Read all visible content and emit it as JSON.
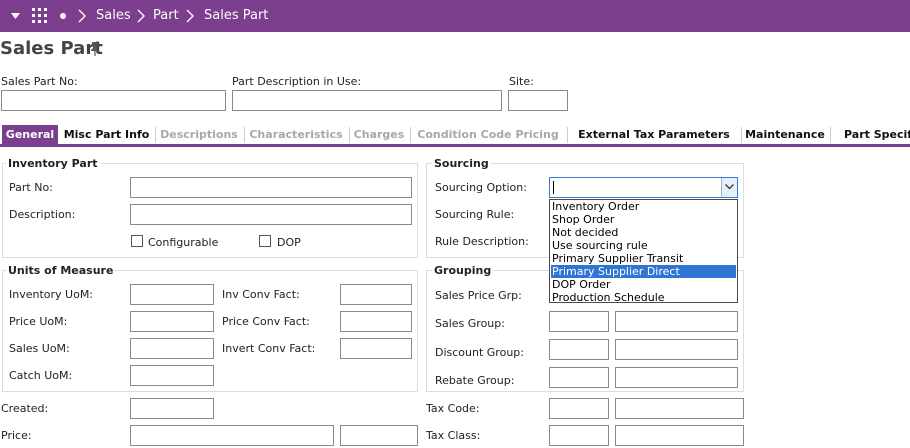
{
  "breadcrumb": [
    "Sales",
    "Part",
    "Sales Part"
  ],
  "page_title": "Sales Part",
  "header_fields": {
    "sales_part_no": {
      "label": "Sales Part No:",
      "value": ""
    },
    "part_description": {
      "label": "Part Description in Use:",
      "value": ""
    },
    "site": {
      "label": "Site:",
      "value": ""
    }
  },
  "tabs": [
    {
      "label": "General",
      "state": "active"
    },
    {
      "label": "Misc Part Info",
      "state": "normal"
    },
    {
      "label": "Descriptions",
      "state": "disabled"
    },
    {
      "label": "Characteristics",
      "state": "disabled"
    },
    {
      "label": "Charges",
      "state": "disabled"
    },
    {
      "label": "Condition Code Pricing",
      "state": "disabled"
    },
    {
      "label": "External Tax Parameters",
      "state": "normal"
    },
    {
      "label": "Maintenance",
      "state": "normal"
    },
    {
      "label": "Part Specif",
      "state": "normal"
    }
  ],
  "inventory_part": {
    "title": "Inventory Part",
    "part_no_label": "Part No:",
    "description_label": "Description:",
    "configurable_label": "Configurable",
    "dop_label": "DOP"
  },
  "sourcing": {
    "title": "Sourcing",
    "option_label": "Sourcing Option:",
    "rule_label": "Sourcing Rule:",
    "rule_description_label": "Rule Description:",
    "options": [
      "Inventory Order",
      "Shop Order",
      "Not decided",
      "Use sourcing rule",
      "Primary Supplier Transit",
      "Primary Supplier Direct",
      "DOP Order",
      "Production Schedule"
    ],
    "highlighted_option": "Primary Supplier Direct"
  },
  "units": {
    "title": "Units of Measure",
    "inventory_uom": "Inventory UoM:",
    "price_uom": "Price UoM:",
    "sales_uom": "Sales UoM:",
    "catch_uom": "Catch UoM:",
    "inv_conv_fact": "Inv Conv Fact:",
    "price_conv_fact": "Price Conv Fact:",
    "invert_conv_fact": "Invert Conv Fact:"
  },
  "grouping": {
    "title": "Grouping",
    "sales_price_grp": "Sales Price Grp:",
    "sales_group": "Sales Group:",
    "discount_group": "Discount Group:",
    "rebate_group": "Rebate Group:"
  },
  "bottom": {
    "created": "Created:",
    "price": "Price:",
    "tax_code": "Tax Code:",
    "tax_class": "Tax Class:"
  },
  "colors": {
    "brand": "#7b3f8e",
    "selection": "#3074d4"
  }
}
